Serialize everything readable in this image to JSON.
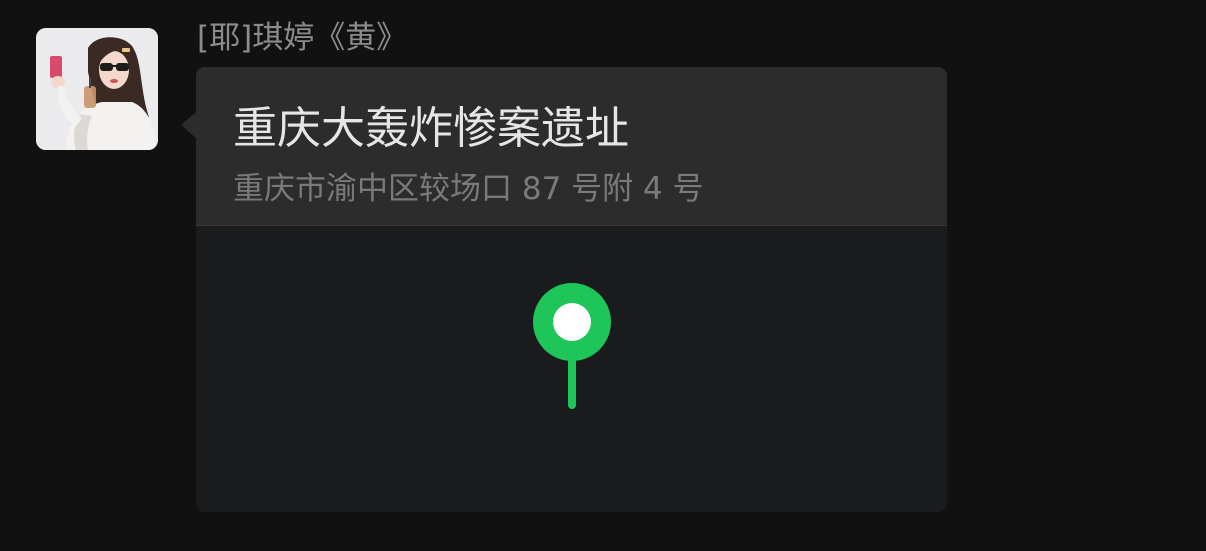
{
  "message": {
    "sender_name": "[耶]琪婷《黄》",
    "avatar": "user-avatar-photo"
  },
  "location": {
    "title": "重庆大轰炸惨案遗址",
    "address": "重庆市渝中区较场口 87 号附 4 号",
    "pin_icon": "map-pin-icon"
  },
  "colors": {
    "background": "#111111",
    "card_header": "#2c2c2c",
    "map_background": "#191b1c",
    "pin_green": "#1ec65a",
    "title_text": "#e6e6e6",
    "subtitle_text": "#7a7a7a",
    "name_text": "#8c8c8c"
  }
}
